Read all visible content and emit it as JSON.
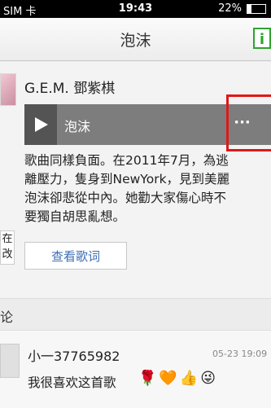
{
  "status_bar": {
    "carrier": "SIM 卡",
    "time": "19:43",
    "battery_percent": "22%",
    "battery_level": 0.22
  },
  "navbar": {
    "title": "泡沫",
    "info_icon_label": "i"
  },
  "song_card": {
    "artist": "G.E.M. 鄧紫棋",
    "song_title": "泡沫",
    "more_label": "···",
    "description_lines": [
      "歌曲同樣負面。在2011年7月，為逃",
      "離壓力，隻身到NewYork，見到美麗",
      "泡沫卻悲從中內。她勸大家傷心時不",
      "要獨自胡思亂想。"
    ],
    "side_badge_text": "在\n改",
    "lyrics_button": "查看歌词"
  },
  "comments_section": {
    "label": "论",
    "comments": [
      {
        "user": "小一37765982",
        "time": "05-23 19:09",
        "text": "我很喜欢这首歌",
        "emojis": [
          "🌹",
          "🧡",
          "👍",
          "😜"
        ]
      }
    ]
  }
}
